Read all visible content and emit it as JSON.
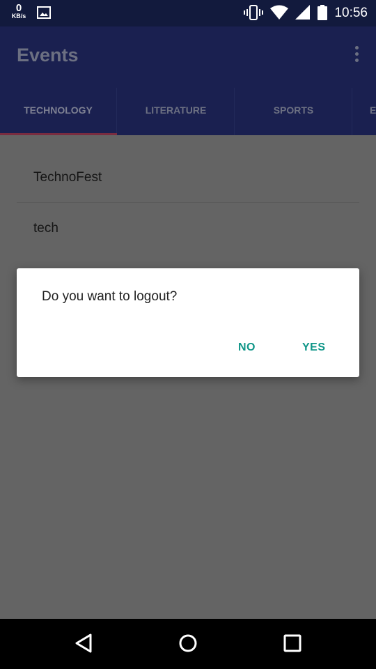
{
  "status_bar": {
    "speed_value": "0",
    "speed_unit": "KB/s",
    "time": "10:56",
    "icons": [
      "image-icon",
      "vibrate-icon",
      "wifi-icon",
      "signal-icon",
      "battery-icon"
    ]
  },
  "app_bar": {
    "title": "Events",
    "menu_icon": "more-vert-icon"
  },
  "tabs": [
    {
      "label": "TECHNOLOGY",
      "active": true
    },
    {
      "label": "LITERATURE",
      "active": false
    },
    {
      "label": "SPORTS",
      "active": false
    },
    {
      "label": "E",
      "active": false
    }
  ],
  "events": [
    {
      "name": "TechnoFest"
    },
    {
      "name": "tech"
    }
  ],
  "dialog": {
    "message": "Do you want to logout?",
    "negative_label": "NO",
    "positive_label": "YES"
  },
  "nav_bar": {
    "icons": [
      "back-icon",
      "home-icon",
      "recents-icon"
    ]
  },
  "colors": {
    "app_bar": "#1a2050",
    "status_bar": "#121a3d",
    "tab_indicator": "#e53955",
    "dialog_button": "#0f9688",
    "scrim": "#646464"
  }
}
